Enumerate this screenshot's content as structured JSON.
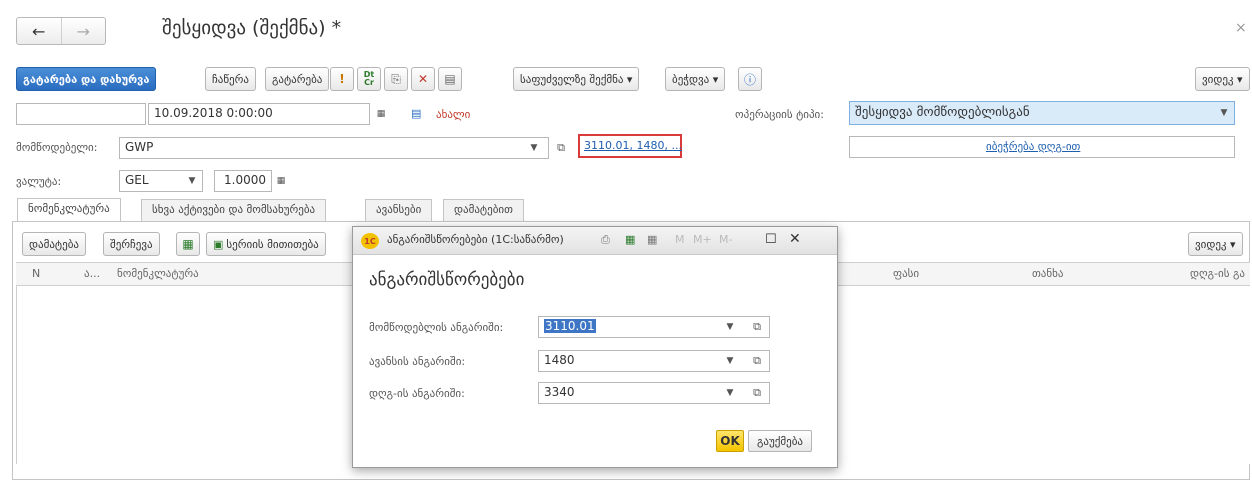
{
  "window": {
    "title": "შესყიდვა (შექმნა) *",
    "back_icon": "←",
    "forward_icon": "→",
    "close_icon": "×"
  },
  "toolbar": {
    "post_close": "გატარება და დახურვა",
    "write": "ჩაწერა",
    "post": "გატარება",
    "create_based_on": "საფუძველზე შექმნა ▾",
    "print": "ბეჭდვა ▾",
    "more": "ვიდეკ ▾",
    "dtcr_icon": "Dt Cr"
  },
  "form": {
    "date": "10.09.2018 0:00:00",
    "status": "ახალი",
    "operation_type_label": "ოპერაციის ტიპი:",
    "operation_type_value": "შესყიდვა მომწოდებლისგან",
    "supplier_label": "მომწოდებელი:",
    "supplier_value": "GWP",
    "accounts_link": "3110.01, 1480, ...",
    "invoice_link": "იბეჭრება დღგ-ით",
    "currency_label": "ვალუტა:",
    "currency_value": "GEL",
    "rate_value": "1.0000"
  },
  "tabs": [
    {
      "label": "ნომენკლატურა"
    },
    {
      "label": "სხვა აქტივები და მომსახურება"
    },
    {
      "label": "ავანსები"
    },
    {
      "label": "დამატებით"
    }
  ],
  "grid_toolbar": {
    "add": "დამატება",
    "pick": "შერჩევა",
    "fill": "სერიის მითითება",
    "more": "ვიდეკ ▾"
  },
  "grid_columns": {
    "n": "N",
    "a": "ა...",
    "nomenclature": "ნომენკლატურა",
    "price": "ფასი",
    "amount": "თანხა",
    "vat": "დღგ-ის გა"
  },
  "dialog": {
    "logo": "1С",
    "title": "ანგარიშსწორებები (1C:საწარმო)",
    "heading": "ანგარიშსწორებები",
    "supplier_account_label": "მომწოდებლის ანგარიში:",
    "supplier_account_value": "3110.01",
    "advance_account_label": "ავანსის ანგარიში:",
    "advance_account_value": "1480",
    "vat_account_label": "დღგ-ის ანგარიში:",
    "vat_account_value": "3340",
    "ok": "OK",
    "cancel": "გაუქმება",
    "m_labels": [
      "M",
      "M+",
      "M-"
    ]
  }
}
